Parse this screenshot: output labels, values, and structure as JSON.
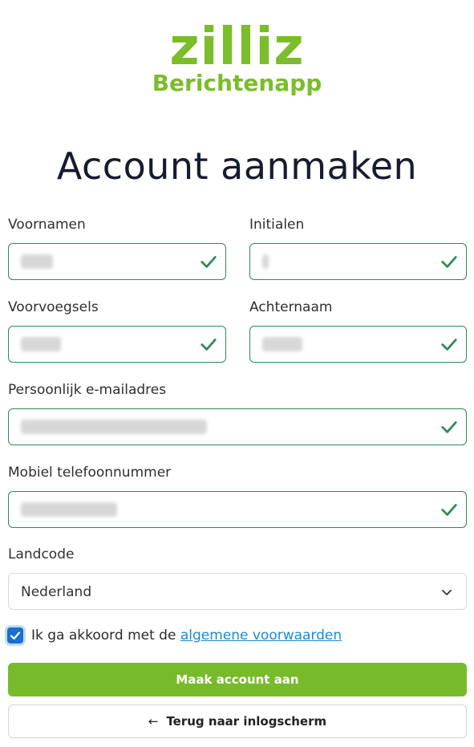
{
  "brand": {
    "wordmark": "zilliz",
    "subtitle": "Berichtenapp",
    "color": "#7bbd2a"
  },
  "page": {
    "title": "Account aanmaken"
  },
  "form": {
    "first_names": {
      "label": "Voornamen",
      "valid": true
    },
    "initials": {
      "label": "Initialen",
      "valid": true
    },
    "prefixes": {
      "label": "Voorvoegsels",
      "valid": true
    },
    "last_name": {
      "label": "Achternaam",
      "valid": true
    },
    "email": {
      "label": "Persoonlijk e-mailadres",
      "valid": true
    },
    "mobile": {
      "label": "Mobiel telefoonnummer",
      "valid": true
    },
    "country_code": {
      "label": "Landcode",
      "selected": "Nederland"
    },
    "terms": {
      "checked": true,
      "prefix": "Ik ga akkoord met de",
      "link": "algemene voorwaarden"
    },
    "submit_label": "Maak account aan",
    "back_label": "Terug naar inlogscherm"
  },
  "icons": {
    "valid": "check-icon",
    "select": "chevron-down-icon",
    "back": "arrow-left-icon"
  },
  "colors": {
    "valid_border": "#2e8a57",
    "primary": "#78bb2a",
    "link": "#1a8ad1",
    "checkbox": "#1a6fd1"
  }
}
